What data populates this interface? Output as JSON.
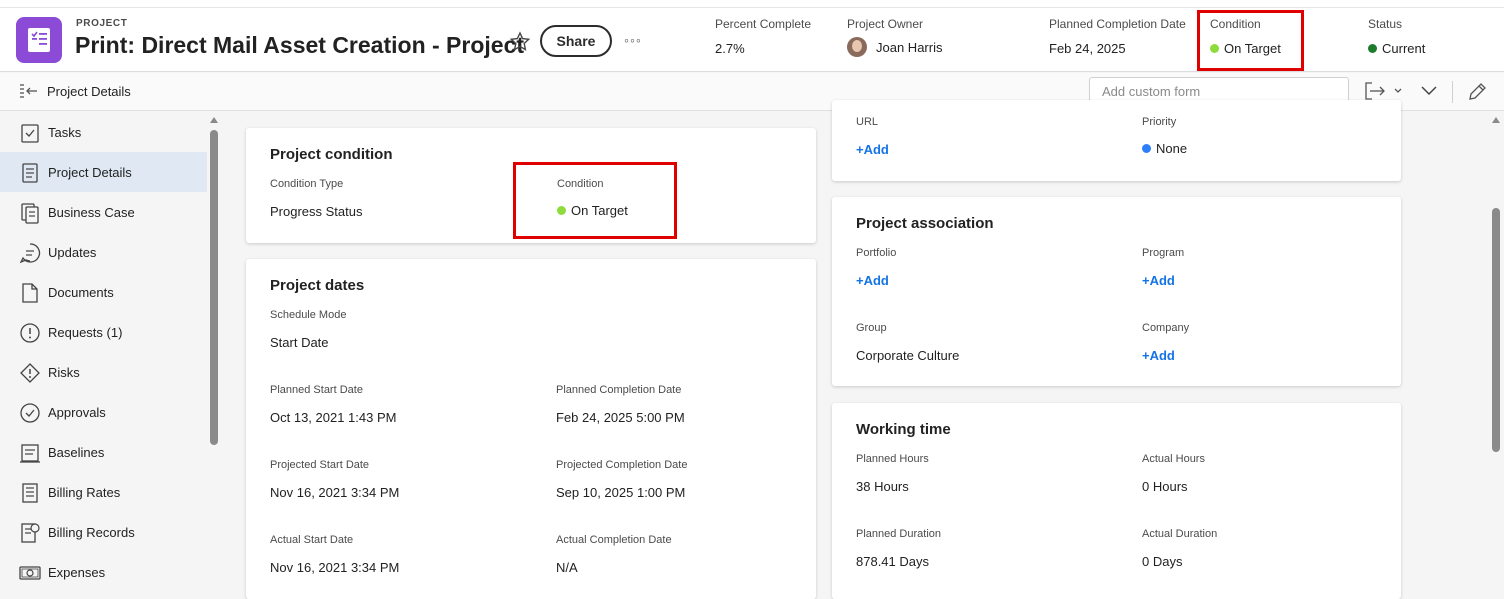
{
  "header": {
    "kind": "PROJECT",
    "title": "Print: Direct Mail Asset Creation - Project",
    "share_label": "Share",
    "more_label": "◦◦◦",
    "fields": {
      "percent_complete": {
        "label": "Percent Complete",
        "value": "2.7%"
      },
      "owner": {
        "label": "Project Owner",
        "value": "Joan Harris"
      },
      "planned_completion": {
        "label": "Planned Completion Date",
        "value": "Feb 24, 2025"
      },
      "condition": {
        "label": "Condition",
        "value": "On Target",
        "color": "#8ddc3b"
      },
      "status": {
        "label": "Status",
        "value": "Current",
        "color": "#1c7c2c"
      }
    }
  },
  "toolbar": {
    "title": "Project Details",
    "custom_form_placeholder": "Add custom form"
  },
  "sidebar": {
    "items": [
      {
        "label": "Tasks",
        "icon": "tasks-icon"
      },
      {
        "label": "Project Details",
        "icon": "details-icon",
        "active": true
      },
      {
        "label": "Business Case",
        "icon": "business-case-icon"
      },
      {
        "label": "Updates",
        "icon": "updates-icon"
      },
      {
        "label": "Documents",
        "icon": "document-icon"
      },
      {
        "label": "Requests (1)",
        "icon": "requests-icon"
      },
      {
        "label": "Risks",
        "icon": "risks-icon"
      },
      {
        "label": "Approvals",
        "icon": "approvals-icon"
      },
      {
        "label": "Baselines",
        "icon": "baselines-icon"
      },
      {
        "label": "Billing Rates",
        "icon": "billing-rates-icon"
      },
      {
        "label": "Billing Records",
        "icon": "billing-records-icon"
      },
      {
        "label": "Expenses",
        "icon": "expenses-icon"
      }
    ]
  },
  "condition_card": {
    "title": "Project condition",
    "condition_type_label": "Condition Type",
    "condition_type_value": "Progress Status",
    "condition_label": "Condition",
    "condition_value": "On Target",
    "condition_color": "#8ddc3b"
  },
  "dates_card": {
    "title": "Project dates",
    "schedule_mode_label": "Schedule Mode",
    "schedule_mode_value": "Start Date",
    "planned_start_label": "Planned Start Date",
    "planned_start_value": "Oct 13, 2021 1:43 PM",
    "planned_completion_label": "Planned Completion Date",
    "planned_completion_value": "Feb 24, 2025 5:00 PM",
    "projected_start_label": "Projected Start Date",
    "projected_start_value": "Nov 16, 2021 3:34 PM",
    "projected_completion_label": "Projected Completion Date",
    "projected_completion_value": "Sep 10, 2025 1:00 PM",
    "actual_start_label": "Actual Start Date",
    "actual_start_value": "Nov 16, 2021 3:34 PM",
    "actual_completion_label": "Actual Completion Date",
    "actual_completion_value": "N/A"
  },
  "url_card": {
    "url_label": "URL",
    "url_add": "+Add",
    "priority_label": "Priority",
    "priority_value": "None",
    "priority_color": "#2d7ff9"
  },
  "association_card": {
    "title": "Project association",
    "portfolio_label": "Portfolio",
    "portfolio_add": "+Add",
    "program_label": "Program",
    "program_add": "+Add",
    "group_label": "Group",
    "group_value": "Corporate Culture",
    "company_label": "Company",
    "company_add": "+Add"
  },
  "working_time_card": {
    "title": "Working time",
    "planned_hours_label": "Planned Hours",
    "planned_hours_value": "38 Hours",
    "actual_hours_label": "Actual Hours",
    "actual_hours_value": "0 Hours",
    "planned_duration_label": "Planned Duration",
    "planned_duration_value": "878.41 Days",
    "actual_duration_label": "Actual Duration",
    "actual_duration_value": "0 Days"
  }
}
